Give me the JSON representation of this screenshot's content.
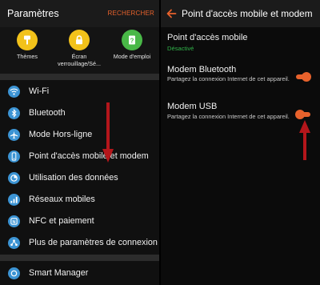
{
  "left_panel": {
    "title": "Paramètres",
    "search_label": "RECHERCHER",
    "quick_settings": [
      {
        "label": "Thèmes",
        "icon": "paintbrush-icon",
        "color": "#f2c21a"
      },
      {
        "label": "Écran verrouillage/Sé...",
        "icon": "lock-icon",
        "color": "#f2c21a"
      },
      {
        "label": "Mode d'emploi",
        "icon": "help-book-icon",
        "color": "#49b847"
      }
    ],
    "items": [
      {
        "label": "Wi-Fi",
        "icon": "wifi-icon"
      },
      {
        "label": "Bluetooth",
        "icon": "bluetooth-icon"
      },
      {
        "label": "Mode Hors-ligne",
        "icon": "airplane-icon"
      },
      {
        "label": "Point d'accès mobile et modem",
        "icon": "hotspot-icon"
      },
      {
        "label": "Utilisation des données",
        "icon": "data-usage-icon"
      },
      {
        "label": "Réseaux mobiles",
        "icon": "mobile-network-icon"
      },
      {
        "label": "NFC et paiement",
        "icon": "nfc-icon"
      },
      {
        "label": "Plus de paramètres de connexion",
        "icon": "more-connections-icon"
      },
      {
        "label": "Smart Manager",
        "icon": "smart-manager-icon"
      }
    ]
  },
  "right_panel": {
    "title": "Point d'accès mobile et modem",
    "options": [
      {
        "title": "Point d'accès mobile",
        "status": "Désactivé"
      },
      {
        "title": "Modem Bluetooth",
        "description": "Partagez la connexion Internet de cet appareil.",
        "toggle": "on"
      },
      {
        "title": "Modem USB",
        "description": "Partagez la connexion Internet de cet appareil.",
        "toggle": "on"
      }
    ]
  },
  "colors": {
    "accent": "#e8622c",
    "icon_blue": "#3c94d4",
    "status_green": "#31b44a",
    "annotation_arrow": "#b4161b"
  }
}
